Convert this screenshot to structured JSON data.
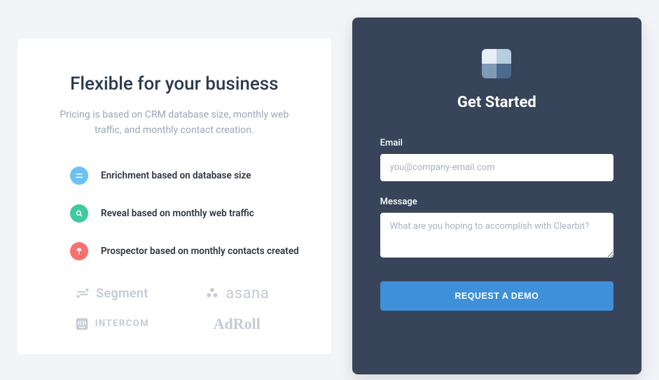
{
  "left": {
    "title": "Flexible for your business",
    "subtitle": "Pricing is based on CRM database size, monthly web traffic, and monthly contact creation.",
    "features": [
      {
        "text": "Enrichment based on database size"
      },
      {
        "text": "Reveal based on monthly web traffic"
      },
      {
        "text": "Prospector based on monthly contacts created"
      }
    ],
    "logos": {
      "segment": "Segment",
      "asana": "asana",
      "intercom": "INTERCOM",
      "adroll": "AdRoll"
    }
  },
  "right": {
    "title": "Get Started",
    "email_label": "Email",
    "email_placeholder": "you@company-email.com",
    "message_label": "Message",
    "message_placeholder": "What are you hoping to accomplish with Clearbit?",
    "submit_label": "REQUEST A DEMO"
  }
}
